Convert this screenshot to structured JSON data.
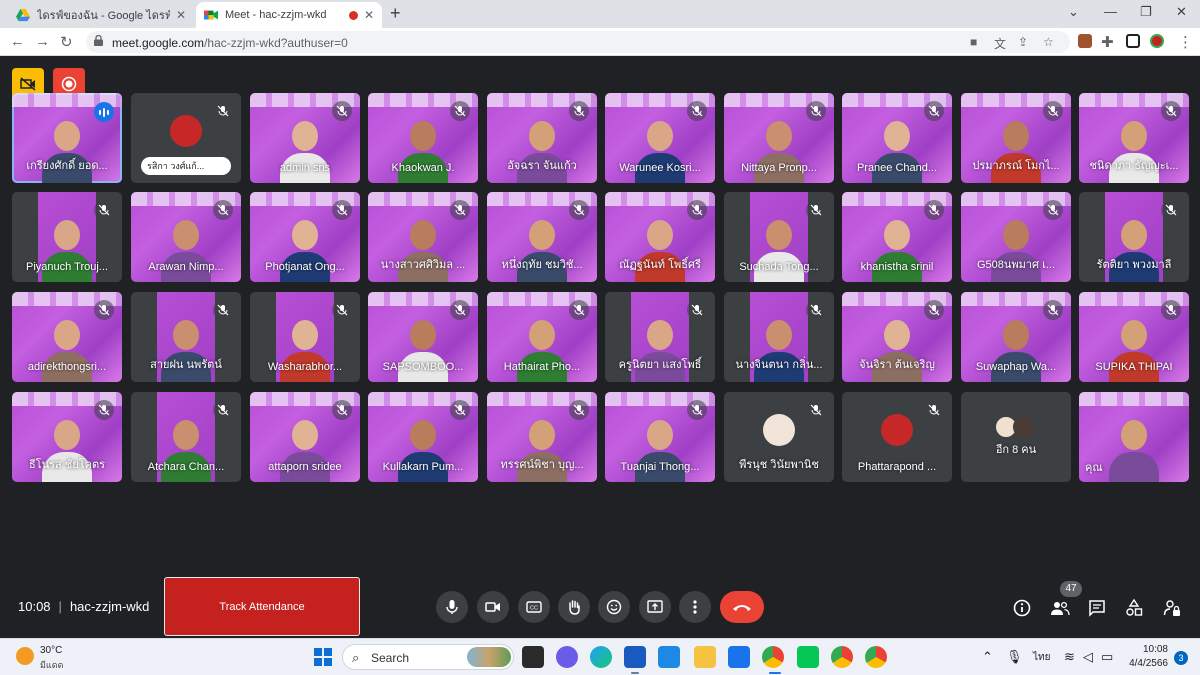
{
  "browser": {
    "tabs": [
      {
        "title": "ไดรฟ์ของฉัน - Google ไดรฟ์",
        "active": false
      },
      {
        "title": "Meet - hac-zzjm-wkd",
        "active": true
      }
    ],
    "url_host": "meet.google.com",
    "url_path": "/hac-zzjm-wkd?authuser=0"
  },
  "meeting": {
    "time": "10:08",
    "code": "hac-zzjm-wkd",
    "attendance_label": "Track Attendance",
    "people_count": "47"
  },
  "participants": [
    {
      "name": "เกรียงศักดิ์ ยอด...",
      "kind": "slide",
      "speaking": true
    },
    {
      "name": "รสิกา วงศ์แก้...",
      "kind": "avatar",
      "pinned": true
    },
    {
      "name": "admin sns",
      "kind": "slide"
    },
    {
      "name": "Khaokwan J.",
      "kind": "slide"
    },
    {
      "name": "อัจฉรา จันแก้ว",
      "kind": "slide"
    },
    {
      "name": "Warunee Kosri...",
      "kind": "slide"
    },
    {
      "name": "Nittaya Pronp...",
      "kind": "slide"
    },
    {
      "name": "Pranee Chand...",
      "kind": "slide"
    },
    {
      "name": "ปรมาภรณ์ โมกไ...",
      "kind": "slide"
    },
    {
      "name": "ชนิดาภา ธัญญะเ...",
      "kind": "slide"
    },
    {
      "name": "Piyanuch Trouj...",
      "kind": "split"
    },
    {
      "name": "Arawan Nimp...",
      "kind": "slide"
    },
    {
      "name": "Photjanat Ong...",
      "kind": "slide"
    },
    {
      "name": "นางสาวศศิวิมล ...",
      "kind": "slide"
    },
    {
      "name": "หนึ่งฤทัย ชมวิชั...",
      "kind": "slide"
    },
    {
      "name": "ณัฏฐนันท์ โพธิ์ศรี",
      "kind": "slide"
    },
    {
      "name": "Suchada Tong...",
      "kind": "split"
    },
    {
      "name": "khanistha srinil",
      "kind": "slide"
    },
    {
      "name": "G508นพมาศ เ...",
      "kind": "slide"
    },
    {
      "name": "รัตติยา พวงมาลี",
      "kind": "split"
    },
    {
      "name": "adirekthongsri...",
      "kind": "slide"
    },
    {
      "name": "สายฝน นพรัตน์",
      "kind": "split"
    },
    {
      "name": "Washarabhor...",
      "kind": "split"
    },
    {
      "name": "SAPSOMBOO...",
      "kind": "slide"
    },
    {
      "name": "Hathairat Pho...",
      "kind": "slide"
    },
    {
      "name": "ครูนิตยา แสงโพธิ์",
      "kind": "split"
    },
    {
      "name": "นางจินตนา กลิ่น...",
      "kind": "split"
    },
    {
      "name": "จันจิรา ต้นเจริญ",
      "kind": "slide"
    },
    {
      "name": "Suwaphap Wa...",
      "kind": "slide"
    },
    {
      "name": "SUPIKA THIPAI",
      "kind": "slide"
    },
    {
      "name": "ธีโนรส ชัยโคตร",
      "kind": "slide"
    },
    {
      "name": "Atchara Chan...",
      "kind": "split"
    },
    {
      "name": "attaporn sridee",
      "kind": "slide"
    },
    {
      "name": "Kullakarn Pum...",
      "kind": "slide"
    },
    {
      "name": "ทรรศน์พิชา บุญ...",
      "kind": "slide"
    },
    {
      "name": "Tuanjai Thong...",
      "kind": "slide"
    },
    {
      "name": "พีรนุช วินัยพานิช",
      "kind": "avatar"
    },
    {
      "name": "Phattarapond ...",
      "kind": "avatar"
    },
    {
      "name": "อีก 8 คน",
      "kind": "more"
    },
    {
      "name": "คุณ",
      "kind": "slide",
      "self": true
    }
  ],
  "taskbar": {
    "temperature": "30°C",
    "weather": "มีแดด",
    "search_label": "Search",
    "language": "ไทย",
    "time": "10:08",
    "date": "4/4/2566",
    "notifications": "3"
  },
  "colors": {
    "meet_bg": "#202124",
    "hangup": "#ea4335",
    "attendance": "#c5221f",
    "slide_purple": "#b84fd6",
    "speaking_blue": "#1a73e8"
  }
}
